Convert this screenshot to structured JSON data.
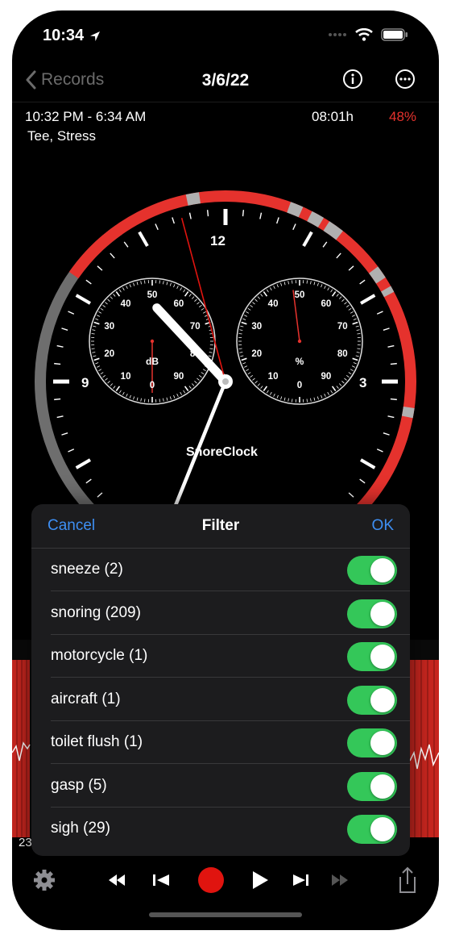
{
  "status_bar": {
    "time": "10:34"
  },
  "nav": {
    "back_label": "Records",
    "title": "3/6/22"
  },
  "record": {
    "time_range": "10:32 PM - 6:34 AM",
    "duration": "08:01h",
    "percent": "48%",
    "tags": "Tee, Stress",
    "percent_color": "#e5322d"
  },
  "clock": {
    "brand": "SnoreClock",
    "hour_labels": [
      "12",
      "9",
      "3"
    ],
    "left_dial": {
      "unit": "dB",
      "ticks": [
        "0",
        "10",
        "20",
        "30",
        "40",
        "50",
        "60",
        "70",
        "80",
        "90"
      ],
      "needle_value": 0
    },
    "right_dial": {
      "unit": "%",
      "ticks": [
        "0",
        "10",
        "20",
        "30",
        "40",
        "50",
        "60",
        "70",
        "80",
        "90"
      ],
      "needle_value": 48
    },
    "accent_red": "#e5322d"
  },
  "wave": {
    "partial_label": "23"
  },
  "filter_sheet": {
    "cancel_label": "Cancel",
    "title": "Filter",
    "ok_label": "OK",
    "items": [
      {
        "label": "sneeze (2)",
        "on": true
      },
      {
        "label": "snoring (209)",
        "on": true
      },
      {
        "label": "motorcycle (1)",
        "on": true
      },
      {
        "label": "aircraft (1)",
        "on": true
      },
      {
        "label": "toilet flush (1)",
        "on": true
      },
      {
        "label": "gasp (5)",
        "on": true
      },
      {
        "label": "sigh (29)",
        "on": true
      }
    ],
    "accent_blue": "#3e8ff3",
    "toggle_green": "#34c759"
  },
  "toolbar": {
    "icons": [
      "gear-icon",
      "rewind-icon",
      "skip-back-icon",
      "record-icon",
      "play-icon",
      "skip-forward-icon",
      "fast-forward-icon",
      "share-icon"
    ]
  }
}
